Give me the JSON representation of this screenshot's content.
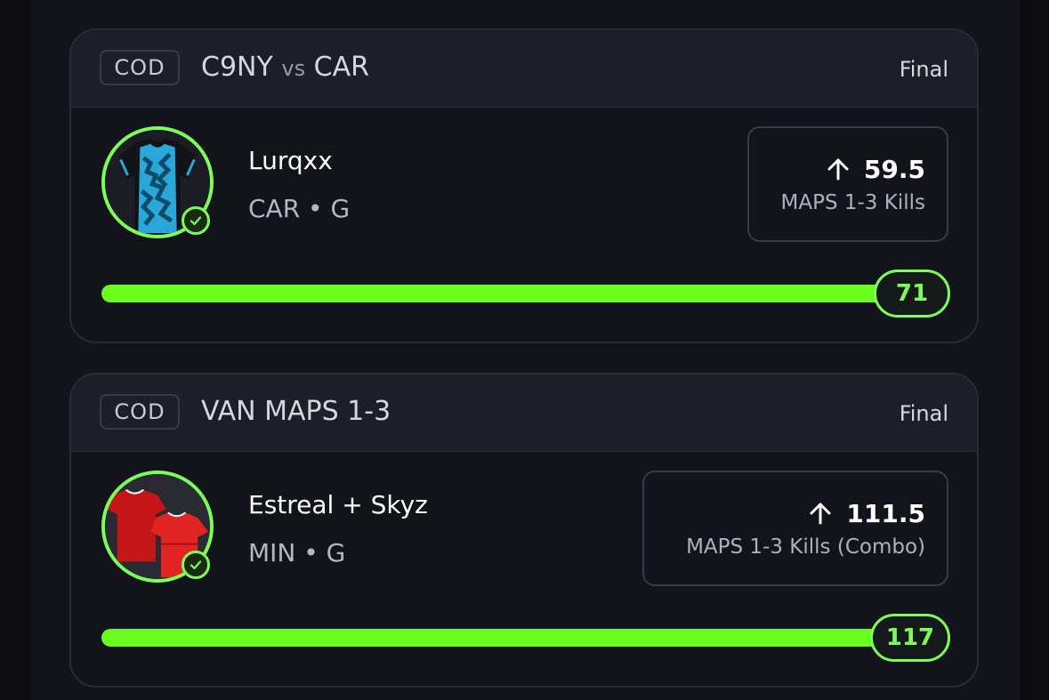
{
  "colors": {
    "accent_green": "#6bff1f",
    "card_bg": "#13131b",
    "header_bg": "#1e1e28"
  },
  "picks": [
    {
      "league": "COD",
      "match_team_a": "C9NY",
      "match_vs": "vs",
      "match_team_b": "CAR",
      "status": "Final",
      "player_name": "Lurqxx",
      "player_meta": "CAR • G",
      "direction_icon": "arrow-up-icon",
      "line": "59.5",
      "stat_label": "MAPS 1-3 Kills",
      "result": "71",
      "progress_fraction": 1.0,
      "jersey_color": "#2ba6d9",
      "avatar_icon": "jersey-icon",
      "verified_icon": "check-circle-icon"
    },
    {
      "league": "COD",
      "match_title": "VAN MAPS 1-3",
      "status": "Final",
      "player_name": "Estreal + Skyz",
      "player_meta": "MIN • G",
      "direction_icon": "arrow-up-icon",
      "line": "111.5",
      "stat_label": "MAPS 1-3 Kills (Combo)",
      "result": "117",
      "progress_fraction": 1.0,
      "jersey_color": "#d31f1f",
      "avatar_icon": "double-jersey-icon",
      "verified_icon": "check-circle-icon"
    }
  ]
}
